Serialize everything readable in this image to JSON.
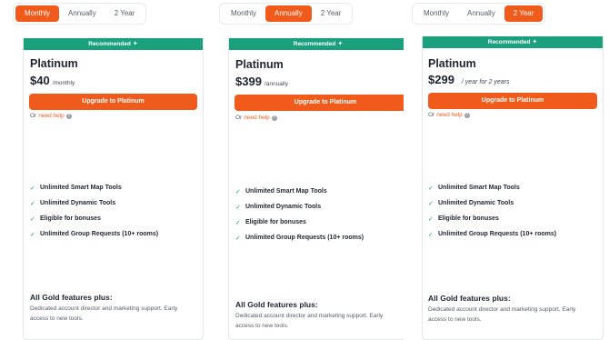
{
  "cards": [
    {
      "toggle": {
        "options": [
          "Monthly",
          "Annually",
          "2 Year"
        ],
        "active": 0
      },
      "banner": "Recommended",
      "banner_icon": "sparkle-icon",
      "plan_name": "Platinum",
      "price": "$40",
      "period": "/monthly",
      "cta": "Upgrade to Platinum",
      "help_prefix": "Or",
      "help_link": "need help",
      "features": [
        "Unlimited Smart Map Tools",
        "Unlimited Dynamic Tools",
        "Eligible for bonuses",
        "Unlimited Group Requests (10+ rooms)"
      ],
      "plus_title": "All Gold features plus:",
      "plus_desc": "Dedicated account director and marketing support. Early access to new tools."
    },
    {
      "toggle": {
        "options": [
          "Monthly",
          "Annually",
          "2 Year"
        ],
        "active": 1
      },
      "banner": "Recommended",
      "banner_icon": "sparkle-icon",
      "plan_name": "Platinum",
      "price": "$399",
      "period": "/annually",
      "cta": "Upgrade to Platinum",
      "help_prefix": "Or",
      "help_link": "need help",
      "features": [
        "Unlimited Smart Map Tools",
        "Unlimited Dynamic Tools",
        "Eligible for bonuses",
        "Unlimited Group Requests (10+ rooms)"
      ],
      "plus_title": "All Gold features plus:",
      "plus_desc": "Dedicated account director and marketing support. Early access to new tools."
    },
    {
      "toggle": {
        "options": [
          "Monthly",
          "Annually",
          "2 Year"
        ],
        "active": 2
      },
      "banner": "Recommended",
      "banner_icon": "sparkle-icon",
      "plan_name": "Platinum",
      "price": "$299",
      "period": "/ year for 2 years",
      "cta": "Upgrade to Platinum",
      "help_prefix": "Or",
      "help_link": "need help",
      "features": [
        "Unlimited Smart Map Tools",
        "Unlimited Dynamic Tools",
        "Eligible for bonuses",
        "Unlimited Group Requests (10+ rooms)"
      ],
      "plus_title": "All Gold features plus:",
      "plus_desc": "Dedicated account director and marketing support. Early access to new tools."
    }
  ],
  "colors": {
    "accent": "#f05a1a",
    "banner": "#1aa07d",
    "text": "#1f2430"
  }
}
